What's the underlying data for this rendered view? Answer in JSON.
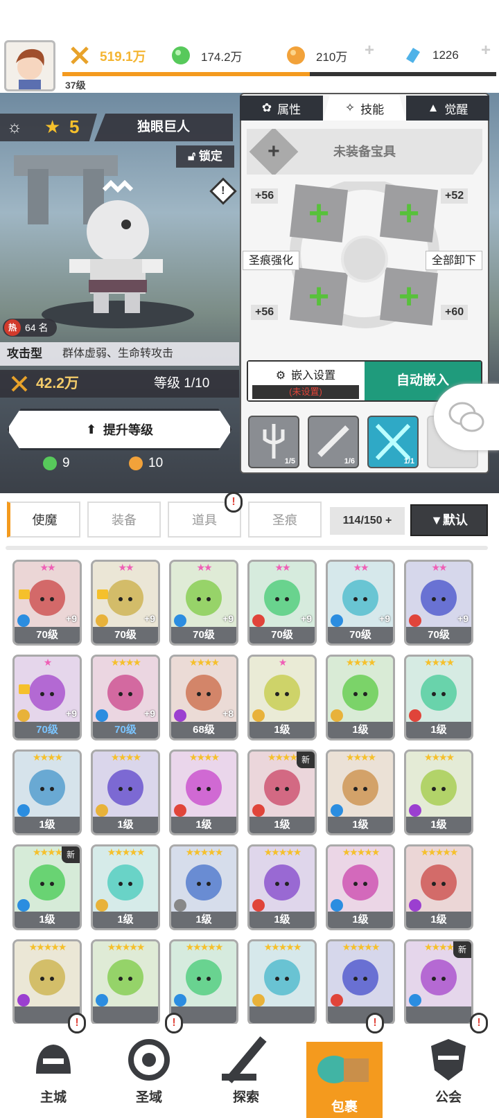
{
  "header": {
    "player_level": "37级",
    "power": "519.1万",
    "green_gems": "174.2万",
    "gold": "210万",
    "diamonds": "1226",
    "xp_progress": 0.57
  },
  "hero": {
    "stars": "5",
    "name": "独眼巨人",
    "lock_label": "锁定",
    "hot_rank": "64 名",
    "hot_icon": "热",
    "type_label": "攻击型",
    "type_desc": "群体虚弱、生命转攻击",
    "power": "42.2万",
    "grade": "等级 1/10",
    "upgrade_label": "提升等级",
    "cost_green": "9",
    "cost_gold": "10"
  },
  "panel": {
    "tabs": [
      "属性",
      "技能",
      "觉醒"
    ],
    "active_tab": 1,
    "unequipped": "未装备宝具",
    "slot_values": [
      "+56",
      "+52",
      "+56",
      "+60"
    ],
    "left_action": "圣痕强化",
    "right_action": "全部卸下",
    "embed_setting": "嵌入设置",
    "embed_status": "(未设置)",
    "auto_embed": "自动嵌入",
    "skills": [
      "1/5",
      "1/6",
      "1/1"
    ]
  },
  "inventory": {
    "tabs": [
      "使魔",
      "装备",
      "道具",
      "圣痕"
    ],
    "count": "114/150",
    "sort": "默认",
    "new_label": "新",
    "cards": [
      {
        "lv": "70级",
        "stars": "★★",
        "plus": "+9",
        "lock": true,
        "elem": "#2b8de0"
      },
      {
        "lv": "70级",
        "stars": "★★",
        "plus": "+9",
        "lock": true,
        "elem": "#e8b23a"
      },
      {
        "lv": "70级",
        "stars": "★★",
        "plus": "+9",
        "elem": "#2b8de0"
      },
      {
        "lv": "70级",
        "stars": "★★",
        "plus": "+9",
        "elem": "#e0443a"
      },
      {
        "lv": "70级",
        "stars": "★★",
        "plus": "+9",
        "elem": "#2b8de0"
      },
      {
        "lv": "70级",
        "stars": "★★",
        "plus": "+9",
        "elem": "#e0443a"
      },
      {
        "lv": "70级",
        "stars": "★",
        "plus": "+9",
        "lock": true,
        "blue": true,
        "elem": "#e8b23a"
      },
      {
        "lv": "70级",
        "stars": "★★★★",
        "plus": "+9",
        "blue": true,
        "elem": "#2b8de0"
      },
      {
        "lv": "68级",
        "stars": "★★★★",
        "plus": "+8",
        "elem": "#9b3fd0"
      },
      {
        "lv": "1级",
        "stars": "★",
        "elem": "#e8b23a"
      },
      {
        "lv": "1级",
        "stars": "★★★★",
        "elem": "#e8b23a"
      },
      {
        "lv": "1级",
        "stars": "★★★★",
        "elem": "#e0443a"
      },
      {
        "lv": "1级",
        "stars": "★★★★",
        "elem": "#2b8de0"
      },
      {
        "lv": "1级",
        "stars": "★★★★",
        "elem": "#e8b23a"
      },
      {
        "lv": "1级",
        "stars": "★★★★",
        "elem": "#e0443a"
      },
      {
        "lv": "1级",
        "stars": "★★★★",
        "new": true,
        "elem": "#e0443a"
      },
      {
        "lv": "1级",
        "stars": "★★★★",
        "elem": "#2b8de0"
      },
      {
        "lv": "1级",
        "stars": "★★★★",
        "elem": "#9b3fd0"
      },
      {
        "lv": "1级",
        "stars": "★★★★",
        "new": true,
        "elem": "#2b8de0"
      },
      {
        "lv": "1级",
        "stars": "★★★★★",
        "elem": "#e8b23a"
      },
      {
        "lv": "1级",
        "stars": "★★★★★",
        "elem": "#888888"
      },
      {
        "lv": "1级",
        "stars": "★★★★★",
        "elem": "#e0443a"
      },
      {
        "lv": "1级",
        "stars": "★★★★★",
        "elem": "#2b8de0"
      },
      {
        "lv": "1级",
        "stars": "★★★★★",
        "elem": "#9b3fd0"
      },
      {
        "lv": "",
        "stars": "★★★★★",
        "elem": "#9b3fd0"
      },
      {
        "lv": "",
        "stars": "★★★★★",
        "elem": "#2b8de0"
      },
      {
        "lv": "",
        "stars": "★★★★★",
        "elem": "#2b8de0"
      },
      {
        "lv": "",
        "stars": "★★★★★",
        "elem": "#e8b23a"
      },
      {
        "lv": "",
        "stars": "★★★★★",
        "elem": "#e0443a"
      },
      {
        "lv": "",
        "stars": "★★★★",
        "new": true,
        "elem": "#2b8de0"
      }
    ]
  },
  "nav": {
    "items": [
      "主城",
      "圣域",
      "探索",
      "包裹",
      "公会"
    ],
    "active": 3
  },
  "colors": {
    "accent": "#f49a1e",
    "teal": "#1f9b7c",
    "dark": "#2f333a"
  }
}
